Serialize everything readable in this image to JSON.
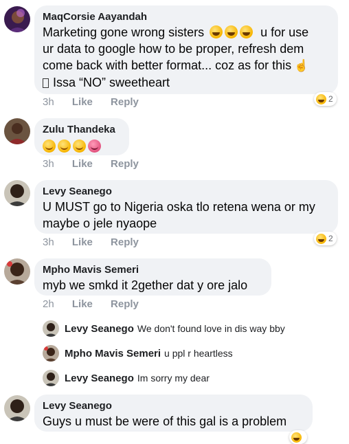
{
  "actions": {
    "like": "Like",
    "reply": "Reply"
  },
  "comments": [
    {
      "author": "MaqCorsie Aayandah",
      "text_1": "Marketing gone wrong sisters",
      "text_1b": "u for use",
      "text_2": "ur data to google how to be proper, refresh dem",
      "text_3": "come back with better format... coz as for this",
      "text_4": "Issa “NO” sweetheart",
      "time": "3h",
      "reactions": "2"
    },
    {
      "author": "Zulu Thandeka",
      "time": "3h"
    },
    {
      "author": "Levy Seanego",
      "text_1": "U MUST go to Nigeria oska tlo retena wena or my",
      "text_2": "maybe o jele nyaope",
      "time": "3h",
      "reactions": "2"
    },
    {
      "author": "Mpho Mavis Semeri",
      "text_1": "myb we smkd it 2gether dat y ore jalo",
      "time": "2h"
    },
    {
      "author": "Levy Seanego",
      "text_1": "Guys u must be were of this gal is a problem"
    }
  ],
  "replies": [
    {
      "author": "Levy Seanego",
      "text": "We don't found love in dis way bby"
    },
    {
      "author": "Mpho Mavis Semeri",
      "text": "u ppl r heartless"
    },
    {
      "author": "Levy Seanego",
      "text": "Im sorry my dear"
    }
  ],
  "icons": {
    "reaction": "haha-reaction-icon",
    "grin": "grinning-face-emoji",
    "smile": "smiling-face-emoji",
    "bug": "bug-emoji",
    "hand": "pointing-up-hand-emoji",
    "missing_glyph": "missing-glyph-box"
  },
  "colors": {
    "bubble": "#f0f2f5",
    "meta": "#8d949e",
    "text": "#050505"
  }
}
